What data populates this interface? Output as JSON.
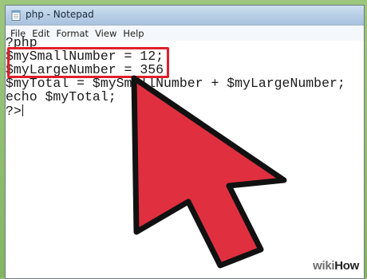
{
  "window": {
    "title": "php - Notepad",
    "icon": "notepad-icon"
  },
  "menu": {
    "items": [
      "File",
      "Edit",
      "Format",
      "View",
      "Help"
    ]
  },
  "editor": {
    "lines": [
      "?php",
      "$mySmallNumber = 12;",
      "$myLargeNumber = 356",
      "$myTotal = $mySmallNumber + $myLargeNumber;",
      "echo $myTotal;",
      "?>"
    ]
  },
  "annotation": {
    "highlight_color": "#e0202a",
    "arrow_color": "#e03040",
    "arrow_outline": "#111111"
  },
  "watermark": {
    "wiki": "wiki",
    "how": "How"
  }
}
